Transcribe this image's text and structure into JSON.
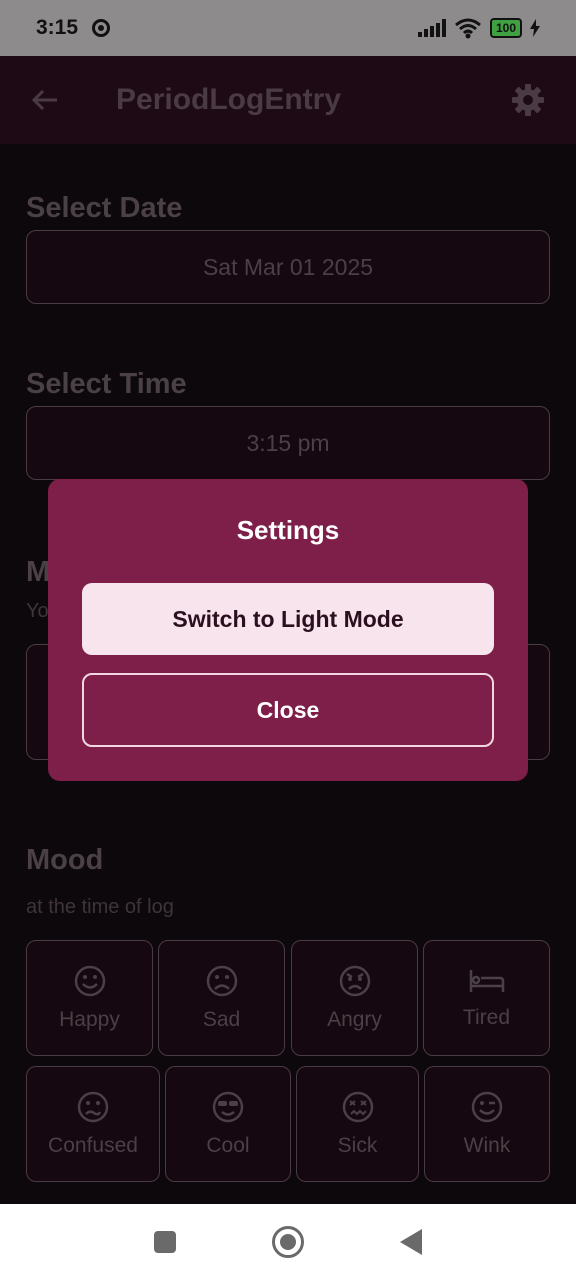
{
  "status": {
    "time": "3:15",
    "battery": "100"
  },
  "app_bar": {
    "title": "PeriodLogEntry"
  },
  "date_section": {
    "label": "Select Date",
    "value": "Sat Mar 01 2025"
  },
  "time_section": {
    "label": "Select Time",
    "value": "3:15 pm"
  },
  "partial_section": {
    "label_fragment": "M",
    "sub_fragment": "Yo"
  },
  "mood_section": {
    "label": "Mood",
    "subtitle": "at the time of log",
    "items": [
      {
        "label": "Happy",
        "icon": "smile-icon"
      },
      {
        "label": "Sad",
        "icon": "sad-icon"
      },
      {
        "label": "Angry",
        "icon": "angry-icon"
      },
      {
        "label": "Tired",
        "icon": "bed-icon"
      },
      {
        "label": "Confused",
        "icon": "confused-icon"
      },
      {
        "label": "Cool",
        "icon": "sunglasses-icon"
      },
      {
        "label": "Sick",
        "icon": "sick-icon"
      },
      {
        "label": "Wink",
        "icon": "wink-icon"
      }
    ]
  },
  "dialog": {
    "title": "Settings",
    "primary_label": "Switch to Light Mode",
    "close_label": "Close"
  },
  "colors": {
    "dialog_bg": "#7e1f4a",
    "primary_button_bg": "#f8e4ec",
    "app_bar_bg": "#1d0a14"
  }
}
